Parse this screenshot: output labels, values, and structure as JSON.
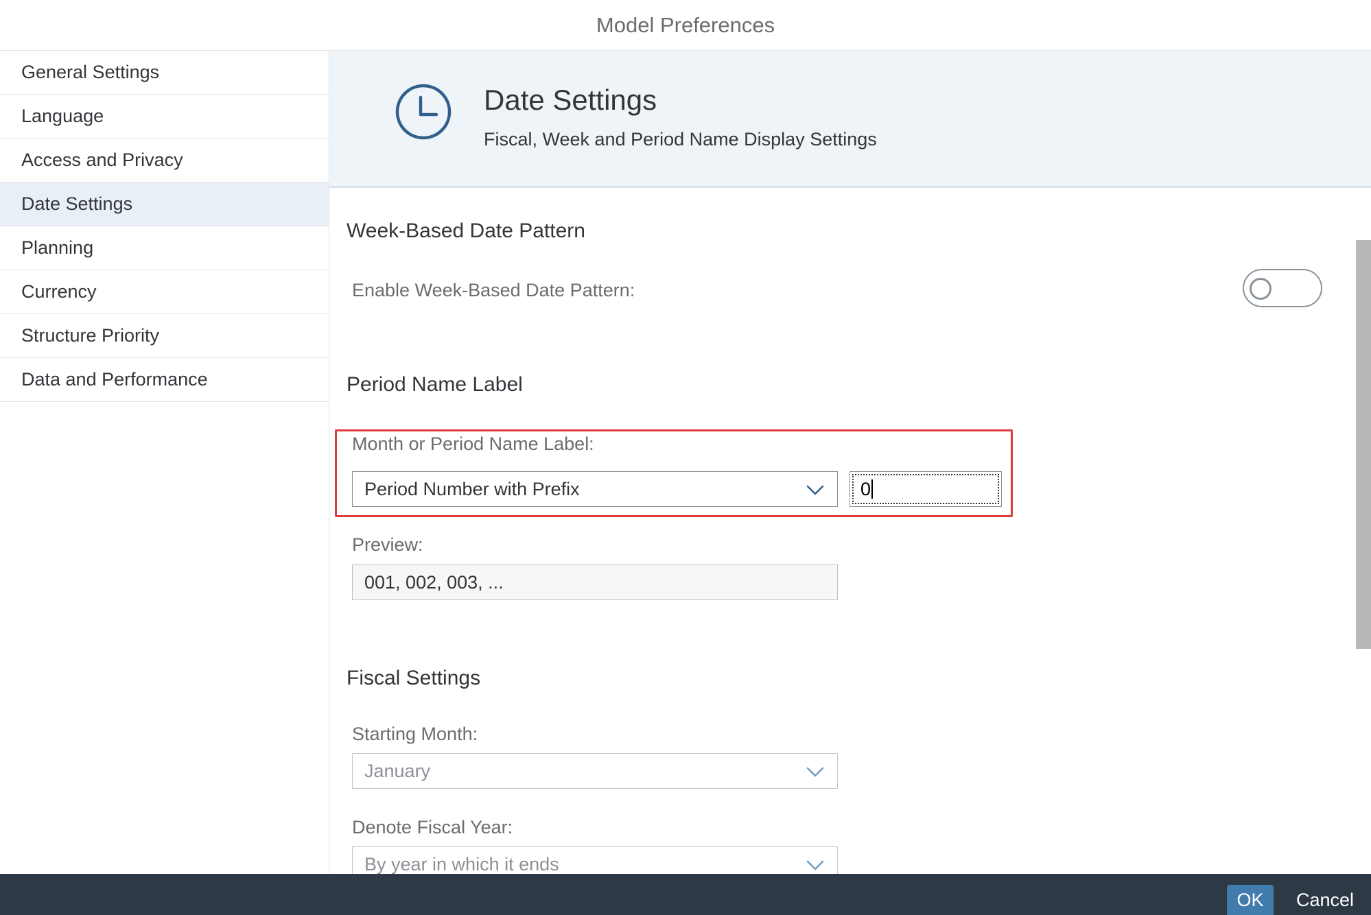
{
  "dialog": {
    "title": "Model Preferences"
  },
  "sidebar": {
    "items": [
      {
        "label": "General Settings"
      },
      {
        "label": "Language"
      },
      {
        "label": "Access and Privacy"
      },
      {
        "label": "Date Settings",
        "selected": true
      },
      {
        "label": "Planning"
      },
      {
        "label": "Currency"
      },
      {
        "label": "Structure Priority"
      },
      {
        "label": "Data and Performance"
      }
    ]
  },
  "header": {
    "icon": "clock-icon",
    "title": "Date Settings",
    "subtitle": "Fiscal, Week and Period Name Display Settings"
  },
  "week_pattern": {
    "title": "Week-Based Date Pattern",
    "enable_label": "Enable Week-Based Date Pattern:",
    "enabled": false
  },
  "period_label": {
    "title": "Period Name Label",
    "field_label": "Month or Period Name Label:",
    "selected_option": "Period Number with Prefix",
    "prefix_value": "0",
    "preview_label": "Preview:",
    "preview_value": "001, 002, 003, ..."
  },
  "fiscal": {
    "title": "Fiscal Settings",
    "starting_month_label": "Starting Month:",
    "starting_month_value": "January",
    "denote_label": "Denote Fiscal Year:",
    "denote_value": "By year in which it ends"
  },
  "footer": {
    "ok_label": "OK",
    "cancel_label": "Cancel"
  },
  "colors": {
    "accent": "#427cac",
    "selected_bg": "#e8eff6",
    "header_bg": "#eff4f9",
    "footer_bg": "#2d3945",
    "highlight": "#e03b3b"
  }
}
